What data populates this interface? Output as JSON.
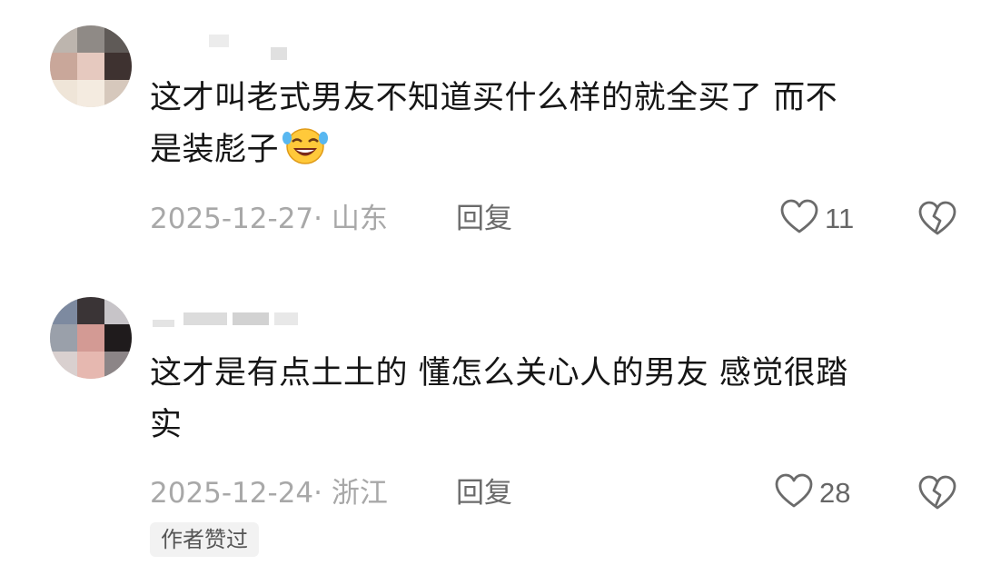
{
  "comments": [
    {
      "text_line1": "这才叫老式男友不知道买什么样的就全买了 而不",
      "text_line2": "是装彪子",
      "emoji": "rolling-on-floor-laughing-emoji",
      "date_location": "2025-12-27· 山东",
      "reply_label": "回复",
      "like_count": "11",
      "icons": {
        "like": "heart-outline-icon",
        "dislike": "broken-heart-icon"
      }
    },
    {
      "text_line1": "这才是有点土土的 懂怎么关心人的男友 感觉很踏",
      "text_line2": "实",
      "date_location": "2025-12-24· 浙江",
      "reply_label": "回复",
      "like_count": "28",
      "author_liked_badge": "作者赞过",
      "icons": {
        "like": "heart-outline-icon",
        "dislike": "broken-heart-icon"
      }
    }
  ],
  "colors": {
    "text": "#161616",
    "meta": "#a8a8a8",
    "reply": "#6b6b6b",
    "badge_bg": "#f2f2f2"
  }
}
